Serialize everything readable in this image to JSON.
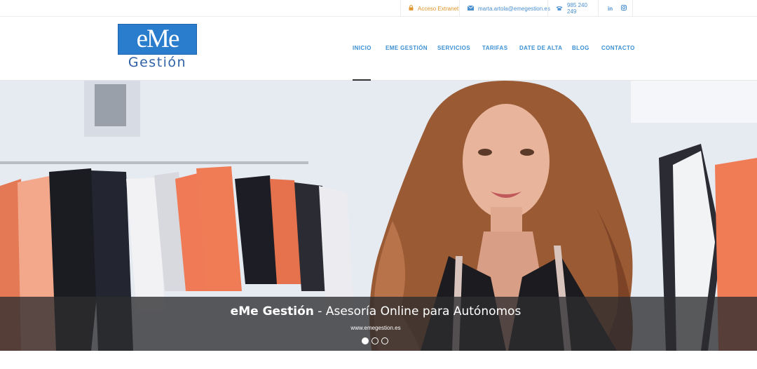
{
  "topbar": {
    "extranet": {
      "label": "Acceso Extranet",
      "icon": "lock-icon"
    },
    "email": {
      "label": "marta.artola@emegestion.es",
      "icon": "envelope-icon"
    },
    "phone": {
      "label": "985 240 249",
      "icon": "phone-icon"
    },
    "social": [
      {
        "label": "in",
        "icon": "linkedin-icon"
      },
      {
        "label": "◙",
        "icon": "instagram-icon"
      }
    ]
  },
  "logo": {
    "main": "eMe",
    "sub": "Gestión"
  },
  "nav": {
    "items": [
      {
        "label": "INICIO",
        "active": true
      },
      {
        "label": "EME GESTIÓN"
      },
      {
        "label": "SERVICIOS"
      },
      {
        "label": "TARIFAS"
      },
      {
        "label": "DATE DE ALTA"
      },
      {
        "label": "BLOG"
      },
      {
        "label": "CONTACTO"
      }
    ]
  },
  "hero": {
    "title_bold": "eMe Gestión",
    "title_rest": " - Asesoría Online para Autónomos",
    "subtitle": "www.emegestion.es",
    "slides": 3,
    "active_slide": 1
  },
  "colors": {
    "accent": "#3b8fd3",
    "extranet": "#e0962c",
    "logo_blue": "#2a7ccd"
  }
}
